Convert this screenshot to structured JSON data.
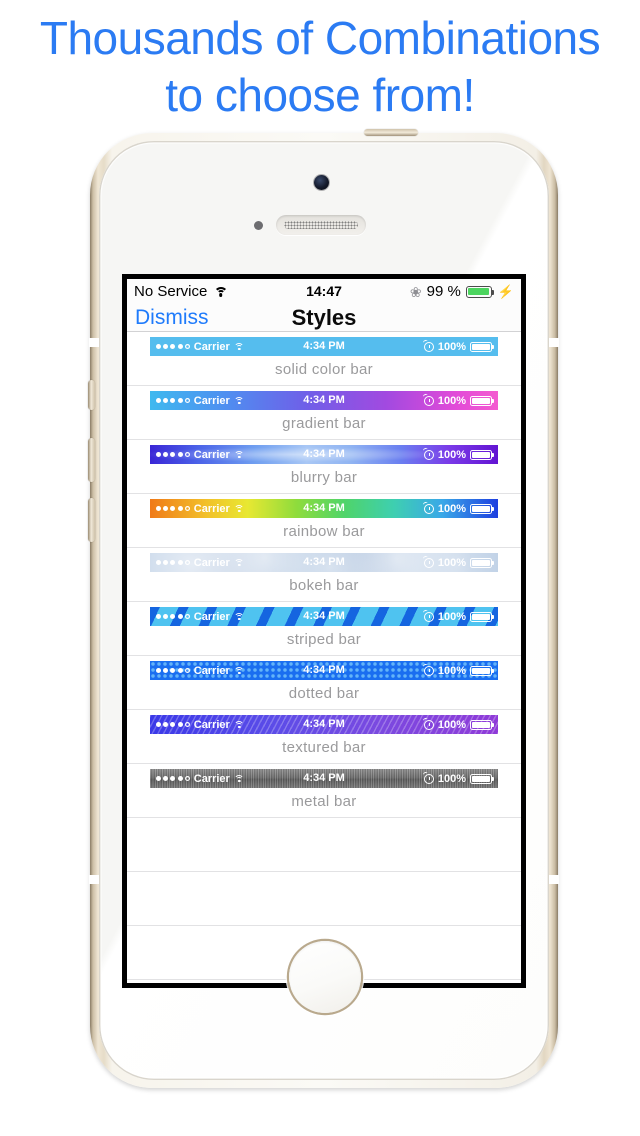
{
  "headline": {
    "line1": "Thousands of Combinations",
    "line2": "to choose from!"
  },
  "device": {
    "name": "iphone-5s-white-gold",
    "camera": "camera-lens",
    "speaker": "earpiece-speaker",
    "home_button": "home-button"
  },
  "screen": {
    "status_bar": {
      "carrier": "No Service",
      "wifi_icon": "wifi-icon",
      "time": "14:47",
      "bluetooth_icon": "bluetooth-icon",
      "battery_percent": "99 %",
      "battery_icon": "battery-icon",
      "charging_icon": "lightning-bolt-icon",
      "battery_color": "#4cd55f"
    },
    "nav_bar": {
      "dismiss_label": "Dismiss",
      "title": "Styles",
      "tint_color": "#1f7bfb"
    },
    "preview_defaults": {
      "carrier": "Carrier",
      "time": "4:34 PM",
      "battery_percent": "100%",
      "signal_dots_filled": 4,
      "signal_dots_total": 5,
      "wifi_icon": "wifi-icon",
      "alarm_icon": "alarm-clock-icon",
      "battery_icon": "battery-icon"
    },
    "rows": [
      {
        "label": "solid color bar",
        "style": "solid",
        "background": "#55bdee",
        "text_color": "#ffffff"
      },
      {
        "label": "gradient bar",
        "style": "gradient",
        "background": "linear-gradient(90deg,#3fb9ef 0%,#4f8ef0 22%,#6f5fe8 45%,#a24ae0 68%,#e24bd8 88%,#f45ad0 100%)",
        "text_color": "#ffffff"
      },
      {
        "label": "blurry bar",
        "style": "blurry",
        "background": "linear-gradient(90deg,#3a26d6 0%,#4b63e8 14%,#6f9ef0 30%,#a8c7f5 45%,#8fb3f2 58%,#6a7ff0 72%,#7a3ae8 86%,#6214d2 100%)",
        "text_color": "#ffffff"
      },
      {
        "label": "rainbow bar",
        "style": "rainbow",
        "background": "linear-gradient(90deg,#f07a18 0%,#f2c02a 16%,#e8e832 28%,#8fdc3c 42%,#4fd46a 56%,#3ecfb0 70%,#3aa8e8 84%,#1e3fe0 100%)",
        "text_color": "#ffffff"
      },
      {
        "label": "bokeh bar",
        "style": "bokeh",
        "background": "#a8c0dd",
        "text_color": "#ffffff"
      },
      {
        "label": "striped bar",
        "style": "striped",
        "background": "#4fc3f0",
        "stripe_color": "#1565e0",
        "text_color": "#ffffff"
      },
      {
        "label": "dotted bar",
        "style": "dotted",
        "background": "#1a6ef0",
        "dot_color": "#63b4f8",
        "text_color": "#ffffff"
      },
      {
        "label": "textured bar",
        "style": "textured",
        "background": "linear-gradient(90deg,#3a38e8 0%,#5b4ce8 35%,#7a4ae0 65%,#8f3ad8 100%)",
        "text_color": "#ffffff"
      },
      {
        "label": "metal bar",
        "style": "metal",
        "background": "linear-gradient(180deg,#8e8e8e 0%,#6f6f6f 45%,#5d5d5d 55%,#7a7a7a 100%)",
        "text_color": "#ffffff"
      }
    ],
    "empty_row_count": 3
  }
}
